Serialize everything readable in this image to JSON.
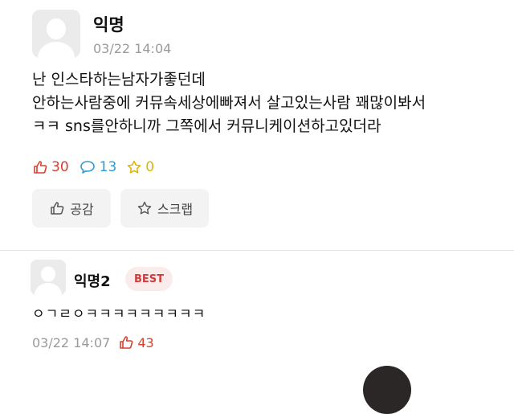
{
  "post": {
    "author": "익명",
    "timestamp": "03/22 14:04",
    "body_lines": [
      "난 인스타하는남자가좋던데",
      "안하는사람중에 커뮤속세상에빠져서 살고있는사람 꽤많이봐서",
      "ㅋㅋ sns를안하니까 그쪽에서 커뮤니케이션하고있더라"
    ],
    "stats": {
      "likes": "30",
      "comments": "13",
      "scraps": "0"
    },
    "actions": {
      "like_label": "공감",
      "scrap_label": "스크랩"
    }
  },
  "comment": {
    "author": "익명2",
    "badge": "BEST",
    "body": "ㅇㄱㄹㅇㅋㅋㅋㅋㅋㅋㅋㅋㅋ",
    "timestamp": "03/22 14:07",
    "likes": "43"
  },
  "colors": {
    "like": "#d6402f",
    "comment": "#2d9bd6",
    "scrap": "#e0b400",
    "badge_text": "#d23b3b",
    "badge_bg": "#fbecec"
  }
}
